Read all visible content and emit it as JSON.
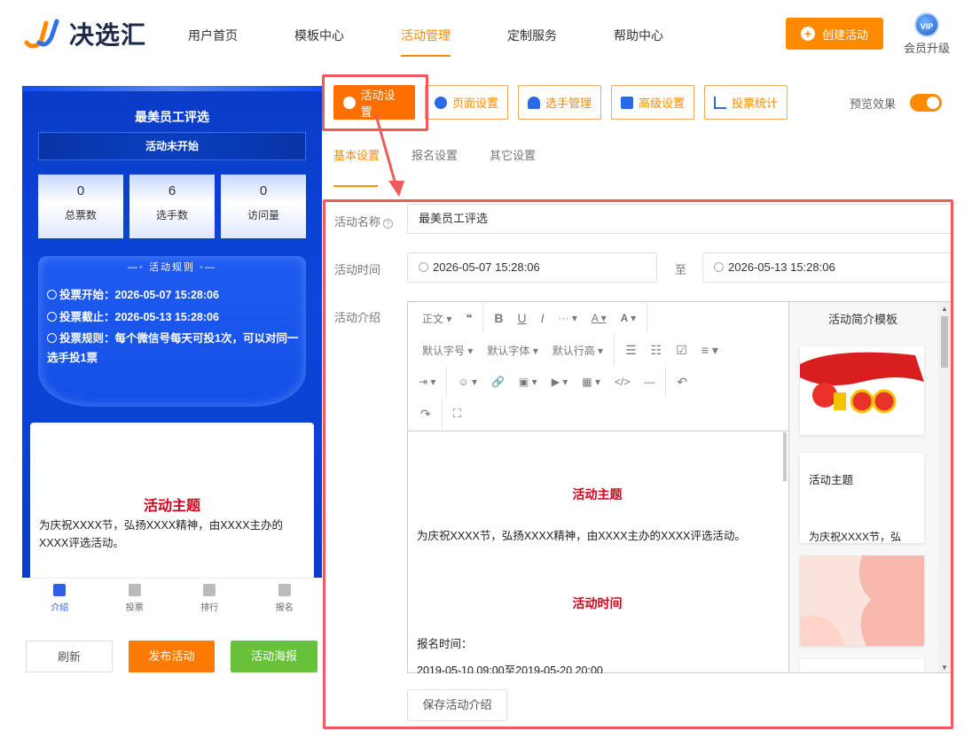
{
  "brand": {
    "name": "决选汇"
  },
  "nav": {
    "items": [
      {
        "label": "用户首页"
      },
      {
        "label": "模板中心"
      },
      {
        "label": "活动管理"
      },
      {
        "label": "定制服务"
      },
      {
        "label": "帮助中心"
      }
    ]
  },
  "header": {
    "create_label": "创建活动",
    "vip_badge": "VIP",
    "vip_label": "会员升级"
  },
  "phone": {
    "title": "最美员工评选",
    "status": "活动未开始",
    "stats": [
      {
        "num": "0",
        "label": "总票数"
      },
      {
        "num": "6",
        "label": "选手数"
      },
      {
        "num": "0",
        "label": "访问量"
      }
    ],
    "rules_title": "—◦ 活动规则 ◦—",
    "rules": [
      "投票开始：2026-05-07 15:28:06",
      "投票截止：2026-05-13 15:28:06",
      "投票规则：每个微信号每天可投1次，可以对同一选手投1票"
    ],
    "card_heading": "活动主题",
    "card_text": "为庆祝XXXX节，弘扬XXXX精神，由XXXX主办的XXXX评选活动。",
    "tabbar": [
      {
        "label": "介绍"
      },
      {
        "label": "投票"
      },
      {
        "label": "排行"
      },
      {
        "label": "报名"
      }
    ]
  },
  "actions": {
    "refresh": "刷新",
    "publish": "发布活动",
    "poster": "活动海报"
  },
  "settings_tabs": [
    {
      "label": "活动设置",
      "icon": "settings-circle-icon"
    },
    {
      "label": "页面设置",
      "icon": "gear-icon"
    },
    {
      "label": "选手管理",
      "icon": "users-icon"
    },
    {
      "label": "高级设置",
      "icon": "advanced-settings-icon"
    },
    {
      "label": "投票统计",
      "icon": "bar-chart-icon"
    }
  ],
  "preview": {
    "label": "预览效果",
    "enabled": true
  },
  "sub_tabs": [
    {
      "label": "基本设置"
    },
    {
      "label": "报名设置"
    },
    {
      "label": "其它设置"
    }
  ],
  "form": {
    "name_label": "活动名称",
    "name_value": "最美员工评选",
    "time_label": "活动时间",
    "start_time": "2026-05-07 15:28:06",
    "to_label": "至",
    "end_time": "2026-05-13 15:28:06",
    "intro_label": "活动介绍",
    "save_label": "保存活动介绍"
  },
  "editor": {
    "toolbar_row1": [
      "正文 ▾",
      "❝",
      "B",
      "U",
      "I",
      "··· ▾",
      "A ▾",
      "A ▾"
    ],
    "toolbar_row2": [
      "默认字号 ▾",
      "默认字体 ▾",
      "默认行高 ▾",
      "☰",
      "☷",
      "☑",
      "≡ ▾"
    ],
    "toolbar_row3": [
      "⇥ ▾",
      "☺ ▾",
      "🔗",
      "▣ ▾",
      "▶ ▾",
      "▦ ▾",
      "</>",
      "—",
      "↶"
    ],
    "toolbar_row4": [
      "↷",
      "⛶"
    ],
    "heading1": "活动主题",
    "text1": "为庆祝XXXX节，弘扬XXXX精神，由XXXX主办的XXXX评选活动。",
    "heading2": "活动时间",
    "text2": "报名时间：",
    "text3": "2019-05-10 09:00至2019-05-20 20:00"
  },
  "templates": {
    "title": "活动简介模板",
    "card2_title": "活动主题",
    "card2_text": "为庆祝XXXX节，弘"
  },
  "colors": {
    "accent": "#ff8a00",
    "highlight": "#f05a5a",
    "phone_bg": "#0b47d9",
    "heading_red": "#d0021b"
  }
}
